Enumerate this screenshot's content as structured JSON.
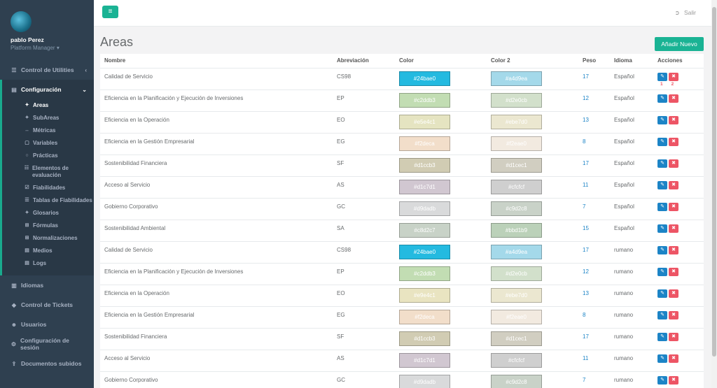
{
  "user": {
    "name": "pablo Perez",
    "role": "Platform Manager"
  },
  "sidebar": {
    "top_items": [
      {
        "label": "Control de Utilities",
        "icon": "☰"
      }
    ],
    "group": {
      "label": "Configuración",
      "icon": "▤",
      "items": [
        {
          "label": "Areas",
          "icon": "✦"
        },
        {
          "label": "SubAreas",
          "icon": "✦"
        },
        {
          "label": "Métricas",
          "icon": "↔"
        },
        {
          "label": "Variables",
          "icon": "▢"
        },
        {
          "label": "Prácticas",
          "icon": "○"
        },
        {
          "label": "Elementos de evaluación",
          "icon": "☷"
        },
        {
          "label": "Fiabilidades",
          "icon": "☑"
        },
        {
          "label": "Tablas de Fiabilidades",
          "icon": "☰"
        },
        {
          "label": "Glosarios",
          "icon": "✦"
        },
        {
          "label": "Fórmulas",
          "icon": "⊞"
        },
        {
          "label": "Normalizaciones",
          "icon": "⊞"
        },
        {
          "label": "Medios",
          "icon": "▤"
        },
        {
          "label": "Logs",
          "icon": "▤"
        }
      ]
    },
    "bottom_items": [
      {
        "label": "Idiomas",
        "icon": "▥"
      },
      {
        "label": "Control de Tickets",
        "icon": "◆"
      },
      {
        "label": "Usuarios",
        "icon": "☻"
      },
      {
        "label": "Configuración de sesión",
        "icon": "⚙"
      },
      {
        "label": "Documentos subidos",
        "icon": "⇪"
      }
    ]
  },
  "topbar": {
    "logout_label": "Salir",
    "menu_icon": "≡"
  },
  "page": {
    "title": "Areas",
    "add_button": "Añadir Nuevo"
  },
  "table": {
    "headers": [
      "Nombre",
      "Abreviación",
      "Color",
      "Color 2",
      "Peso",
      "Idioma",
      "Acciones"
    ],
    "action_marks": [
      "1",
      "2"
    ],
    "rows": [
      {
        "nombre": "Calidad de Servicio",
        "abrev": "CS98",
        "color": "#24bae0",
        "color2": "#a4d9ea",
        "peso": "17",
        "idioma": "Español"
      },
      {
        "nombre": "Eficiencia en la Planificación y Ejecución de Inversiones",
        "abrev": "EP",
        "color": "#c2ddb3",
        "color2": "#d2e0cb",
        "peso": "12",
        "idioma": "Español"
      },
      {
        "nombre": "Eficiencia en la Operación",
        "abrev": "EO",
        "color": "#e5e4c1",
        "color2": "#ebe7d0",
        "peso": "13",
        "idioma": "Español"
      },
      {
        "nombre": "Eficiencia en la Gestión Empresarial",
        "abrev": "EG",
        "color": "#f2deca",
        "color2": "#f2eae0",
        "peso": "8",
        "idioma": "Español"
      },
      {
        "nombre": "Sostenibilidad Financiera",
        "abrev": "SF",
        "color": "#d1ccb3",
        "color2": "#d1cec1",
        "peso": "17",
        "idioma": "Español"
      },
      {
        "nombre": "Acceso al Servicio",
        "abrev": "AS",
        "color": "#d1c7d1",
        "color2": "#cfcfcf",
        "peso": "11",
        "idioma": "Español"
      },
      {
        "nombre": "Gobierno Corporativo",
        "abrev": "GC",
        "color": "#d9dadb",
        "color2": "#c9d2c8",
        "peso": "7",
        "idioma": "Español"
      },
      {
        "nombre": "Sostenibilidad Ambiental",
        "abrev": "SA",
        "color": "#c8d2c7",
        "color2": "#bbd1b9",
        "peso": "15",
        "idioma": "Español"
      },
      {
        "nombre": "Calidad de Servicio",
        "abrev": "CS98",
        "color": "#24bae0",
        "color2": "#a4d9ea",
        "peso": "17",
        "idioma": "rumano"
      },
      {
        "nombre": "Eficiencia en la Planificación y Ejecución de Inversiones",
        "abrev": "EP",
        "color": "#c2ddb3",
        "color2": "#d2e0cb",
        "peso": "12",
        "idioma": "rumano"
      },
      {
        "nombre": "Eficiencia en la Operación",
        "abrev": "EO",
        "color": "#e9e4c1",
        "color2": "#ebe7d0",
        "peso": "13",
        "idioma": "rumano"
      },
      {
        "nombre": "Eficiencia en la Gestión Empresarial",
        "abrev": "EG",
        "color": "#f2deca",
        "color2": "#f2eae0",
        "peso": "8",
        "idioma": "rumano"
      },
      {
        "nombre": "Sostenibilidad Financiera",
        "abrev": "SF",
        "color": "#d1ccb3",
        "color2": "#d1cec1",
        "peso": "17",
        "idioma": "rumano"
      },
      {
        "nombre": "Acceso al Servicio",
        "abrev": "AS",
        "color": "#d1c7d1",
        "color2": "#cfcfcf",
        "peso": "11",
        "idioma": "rumano"
      },
      {
        "nombre": "Gobierno Corporativo",
        "abrev": "GC",
        "color": "#d9dadb",
        "color2": "#c9d2c8",
        "peso": "7",
        "idioma": "rumano"
      }
    ]
  },
  "colors": {
    "accent": "#1ab394",
    "sidebar_bg": "#2f4050",
    "edit": "#1c84c6",
    "delete": "#ed5565"
  }
}
